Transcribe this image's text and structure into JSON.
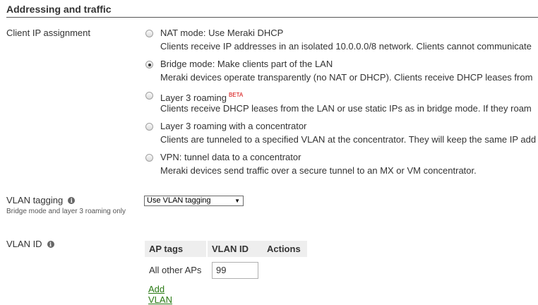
{
  "section": {
    "title": "Addressing and traffic"
  },
  "client_ip": {
    "label": "Client IP assignment",
    "options": [
      {
        "title": "NAT mode: Use Meraki DHCP",
        "description": "Clients receive IP addresses in an isolated 10.0.0.0/8 network. Clients cannot communicate",
        "selected": false
      },
      {
        "title": "Bridge mode: Make clients part of the LAN",
        "description": "Meraki devices operate transparently (no NAT or DHCP). Clients receive DHCP leases from",
        "selected": true
      },
      {
        "title": "Layer 3 roaming",
        "badge": "BETA",
        "description": "Clients receive DHCP leases from the LAN or use static IPs as in bridge mode. If they roam",
        "selected": false
      },
      {
        "title": "Layer 3 roaming with a concentrator",
        "description": "Clients are tunneled to a specified VLAN at the concentrator. They will keep the same IP add",
        "selected": false
      },
      {
        "title": "VPN: tunnel data to a concentrator",
        "description": "Meraki devices send traffic over a secure tunnel to an MX or VM concentrator.",
        "selected": false
      }
    ]
  },
  "vlan_tagging": {
    "label": "VLAN tagging",
    "sublabel": "Bridge mode and layer 3 roaming only",
    "selected_option": "Use VLAN tagging",
    "arrow": "▼"
  },
  "vlan_id": {
    "label": "VLAN ID",
    "columns": [
      "AP tags",
      "VLAN ID",
      "Actions"
    ],
    "rows": [
      {
        "ap_tags": "All other APs",
        "vlan_id": "99"
      }
    ],
    "add_link": "Add VLAN"
  },
  "icons": {
    "info": "i"
  }
}
